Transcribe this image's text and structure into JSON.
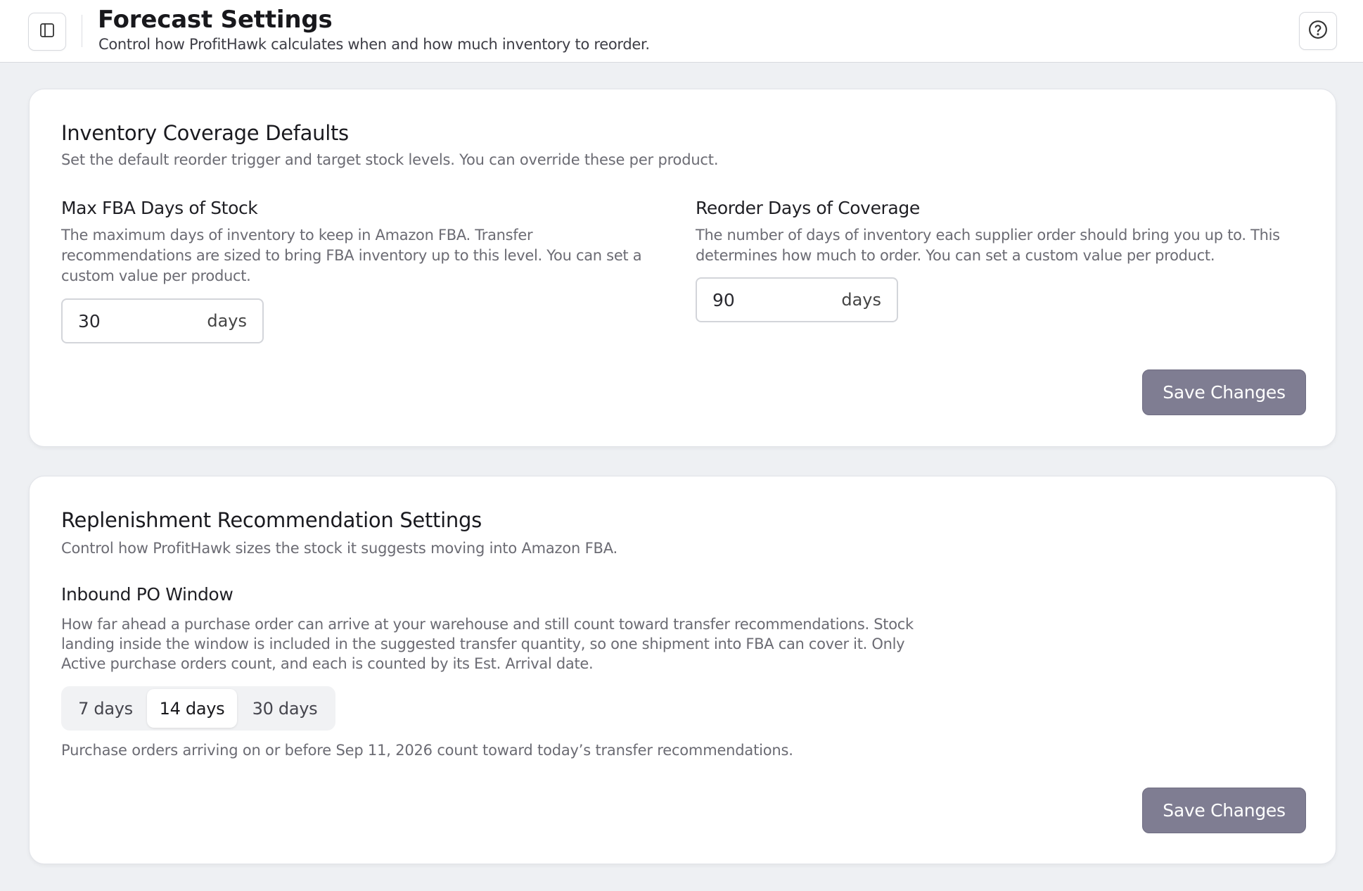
{
  "header": {
    "title": "Forecast Settings",
    "subtitle": "Control how ProfitHawk calculates when and how much inventory to reorder.",
    "sidebar_toggle_icon": "sidebar-panel-icon",
    "help_icon": "help-circle-icon"
  },
  "inventory_coverage": {
    "title": "Inventory Coverage Defaults",
    "description": "Set the default reorder trigger and target stock levels. You can override these per product.",
    "max_fba": {
      "label": "Max FBA Days of Stock",
      "help": "The maximum days of inventory to keep in Amazon FBA. Transfer recommendations are sized to bring FBA inventory up to this level. You can set a custom value per product.",
      "value": "30",
      "unit": "days"
    },
    "reorder_days": {
      "label": "Reorder Days of Coverage",
      "help": "The number of days of inventory each supplier order should bring you up to. This determines how much to order. You can set a custom value per product.",
      "value": "90",
      "unit": "days"
    },
    "save_label": "Save Changes"
  },
  "replenishment": {
    "title": "Replenishment Recommendation Settings",
    "description": "Control how ProfitHawk sizes the stock it suggests moving into Amazon FBA.",
    "inbound_po": {
      "label": "Inbound PO Window",
      "help": "How far ahead a purchase order can arrive at your warehouse and still count toward transfer recommendations. Stock landing inside the window is included in the suggested transfer quantity, so one shipment into FBA can cover it. Only Active purchase orders count, and each is counted by its Est. Arrival date.",
      "options": [
        "7 days",
        "14 days",
        "30 days"
      ],
      "selected": "14 days",
      "note": "Purchase orders arriving on or before Sep 11, 2026 count toward today’s transfer recommendations."
    },
    "save_label": "Save Changes"
  },
  "colors": {
    "background": "#eef0f3",
    "card": "#ffffff",
    "save_button": "#7f7d92"
  }
}
